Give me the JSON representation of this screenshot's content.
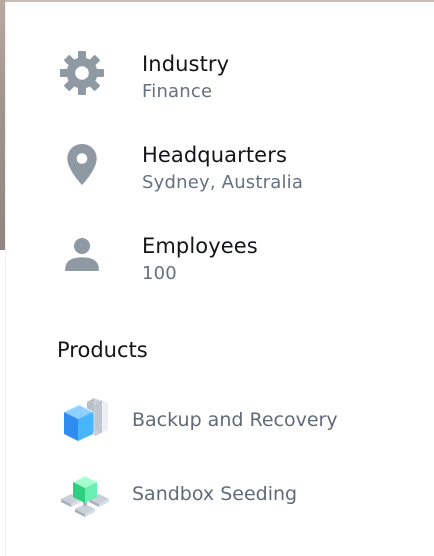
{
  "details": [
    {
      "icon": "gear-icon",
      "title": "Industry",
      "value": "Finance"
    },
    {
      "icon": "location-pin-icon",
      "title": "Headquarters",
      "value": "Sydney, Australia"
    },
    {
      "icon": "person-icon",
      "title": "Employees",
      "value": "100"
    }
  ],
  "products": {
    "heading": "Products",
    "items": [
      {
        "icon": "backup-recovery-icon",
        "label": "Backup and Recovery"
      },
      {
        "icon": "sandbox-seeding-icon",
        "label": "Sandbox Seeding"
      }
    ]
  },
  "colors": {
    "heading": "#121417",
    "muted": "#65717d",
    "icon_gray": "#8f99a3",
    "blue": "#2e8cf0",
    "green": "#2fd07f"
  }
}
